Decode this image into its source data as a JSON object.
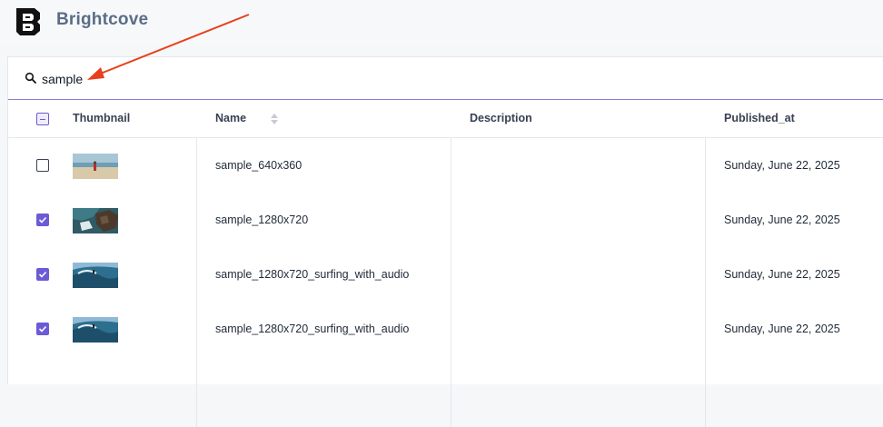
{
  "app": {
    "brand": "Brightcove"
  },
  "search": {
    "value": "sample"
  },
  "table": {
    "columns": [
      "Thumbnail",
      "Name",
      "Description",
      "Published_at"
    ],
    "rows": [
      {
        "checked": false,
        "thumbnail": "beach-person-thumbnail",
        "name": "sample_640x360",
        "description": "",
        "published_at": "Sunday, June 22, 2025"
      },
      {
        "checked": true,
        "thumbnail": "aerial-coast-thumbnail",
        "name": "sample_1280x720",
        "description": "",
        "published_at": "Sunday, June 22, 2025"
      },
      {
        "checked": true,
        "thumbnail": "surfing-wave-thumbnail",
        "name": "sample_1280x720_surfing_with_audio",
        "description": "",
        "published_at": "Sunday, June 22, 2025"
      },
      {
        "checked": true,
        "thumbnail": "surfing-wave-thumbnail",
        "name": "sample_1280x720_surfing_with_audio",
        "description": "",
        "published_at": "Sunday, June 22, 2025"
      }
    ]
  },
  "colors": {
    "accent": "#6c5bd6",
    "annotation_arrow": "#e8401c",
    "brand_text": "#5b6d86"
  }
}
